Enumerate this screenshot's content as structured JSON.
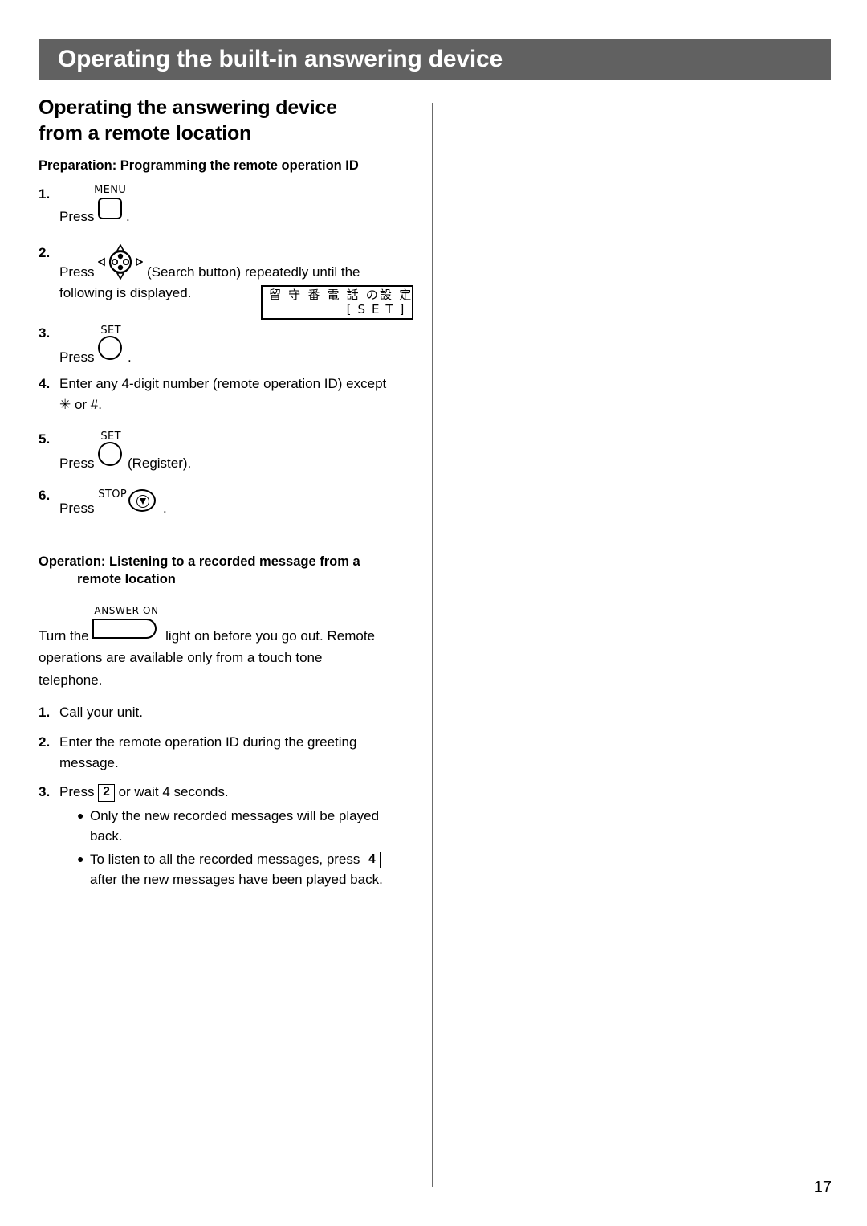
{
  "header": {
    "title": "Operating the built-in answering device",
    "background_color": "#616161",
    "text_color": "#ffffff"
  },
  "section": {
    "title_line1": "Operating the answering device",
    "title_line2": "from a remote location"
  },
  "preparation": {
    "heading": "Preparation: Programming the remote operation ID",
    "steps": [
      {
        "number": "1.",
        "text_before": "Press",
        "icon": "menu-button-icon",
        "icon_label": "MENU",
        "text_after": "."
      },
      {
        "number": "2.",
        "text_before": "Press",
        "icon": "search-navigator-button-icon",
        "text_after": "(Search button) repeatedly until the",
        "text_line2": "following is displayed."
      },
      {
        "number": "3.",
        "text_before": "Press",
        "icon": "set-button-icon",
        "icon_label": "SET",
        "text_after": "."
      },
      {
        "number": "4.",
        "text_line1": "Enter any 4-digit number (remote operation ID) except",
        "text_line2": "✳ or #."
      },
      {
        "number": "5.",
        "text_before": "Press",
        "icon": "set-button-icon",
        "icon_label": "SET",
        "text_after": "(Register)."
      },
      {
        "number": "6.",
        "text_before": "Press",
        "icon": "stop-button-icon",
        "icon_label": "STOP",
        "text_after": "."
      }
    ]
  },
  "lcd_display": {
    "line1": "留 守 番 電 話 の設 定",
    "line2": "[ S E T ]"
  },
  "operation": {
    "heading_line1": "Operation: Listening to a recorded message from a",
    "heading_line2": "remote location",
    "intro_before": "Turn the",
    "intro_icon": "answer-on-button-icon",
    "intro_icon_label": "ANSWER ON",
    "intro_after": "light on before you go out. Remote",
    "intro_line2": "operations are available only from a touch tone",
    "intro_line3": "telephone.",
    "steps": [
      {
        "number": "1.",
        "text": "Call your unit."
      },
      {
        "number": "2.",
        "text_line1": "Enter the remote operation ID during the greeting",
        "text_line2": "message."
      },
      {
        "number": "3.",
        "text_before": "Press",
        "key": "2",
        "text_after": "or wait 4 seconds.",
        "bullets": [
          {
            "line1": "Only the new recorded messages will be played",
            "line2": "back."
          },
          {
            "text_before": "To listen to all the recorded messages, press",
            "key": "4",
            "line2": "after the new messages have been played back."
          }
        ]
      }
    ]
  },
  "footer": {
    "page_number": "17"
  }
}
